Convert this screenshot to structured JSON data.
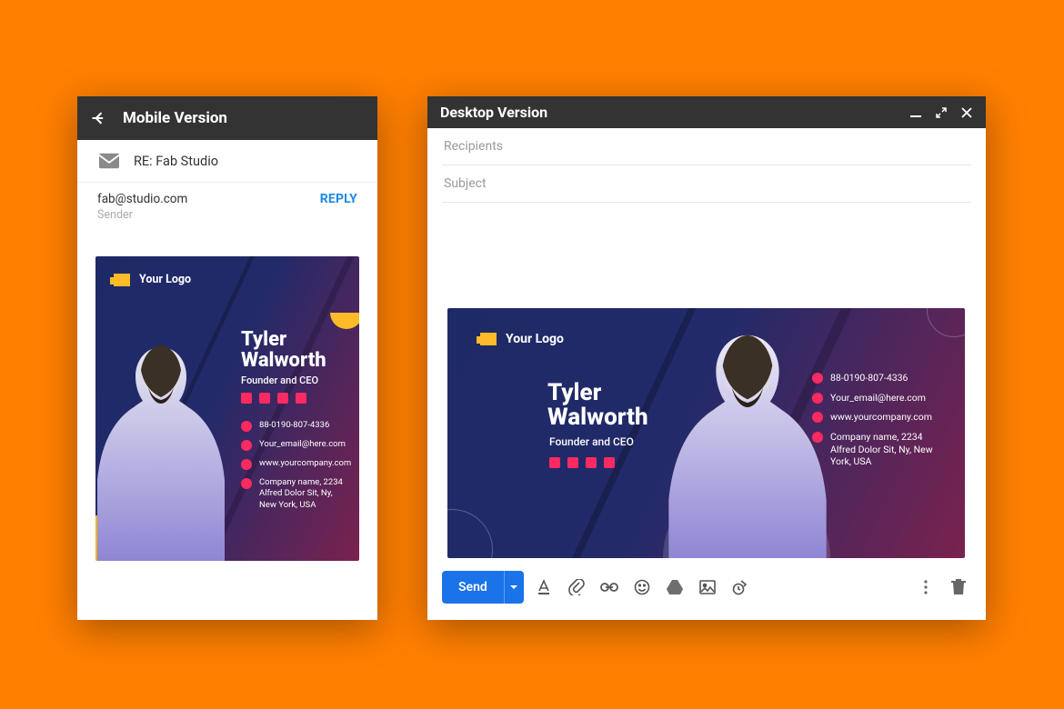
{
  "mobile": {
    "title": "Mobile Version",
    "subject": "RE: Fab Studio",
    "from": "fab@studio.com",
    "sender_label": "Sender",
    "reply": "REPLY"
  },
  "desktop": {
    "title": "Desktop Version",
    "recipients_placeholder": "Recipients",
    "subject_placeholder": "Subject",
    "send": "Send"
  },
  "signature": {
    "logo_text": "Your Logo",
    "name_line1": "Tyler",
    "name_line2": "Walworth",
    "role": "Founder and CEO",
    "phone": "88-0190-807-4336",
    "email": "Your_email@here.com",
    "website": "www.yourcompany.com",
    "address": "Company name, 2234 Alfred Dolor Sit, Ny, New York, USA"
  }
}
